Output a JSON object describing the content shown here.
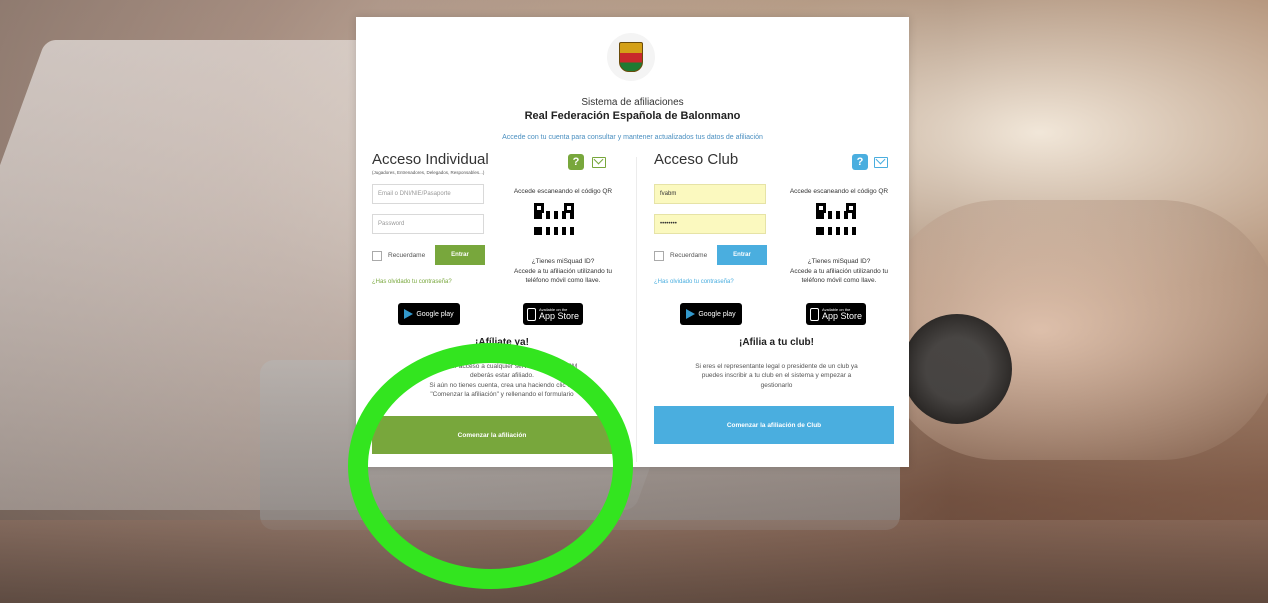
{
  "brand_colors": {
    "green": "#78a73c",
    "blue": "#4aaedf",
    "highlight_ring": "#33e51f"
  },
  "header": {
    "system_name": "Sistema de afiliaciones",
    "federation_name": "Real Federación Española de Balonmano",
    "subtitle": "Accede con tu cuenta para consultar y mantener actualizados tus datos de afiliación",
    "logo_icon": "crest-icon"
  },
  "individual": {
    "title": "Acceso Individual",
    "subtitle": "(Jugadores, Entrenadores, Delegados, Responsables...)",
    "help_icon": "?",
    "email_placeholder": "Email o DNI/NIE/Pasaporte",
    "password_placeholder": "Password",
    "remember_label": "Recuerdame",
    "enter_label": "Entrar",
    "forgot_label": "¿Has olvidado tu contraseña?",
    "qr_title": "Accede escaneando el código QR",
    "qr_question": "¿Tienes miSquad ID?",
    "qr_desc_line1": "Accede a tu afiliación utilizando tu",
    "qr_desc_line2": "teléfono móvil como llave.",
    "google_play_label": "Google play",
    "app_store_small": "Available on the",
    "app_store_big": "App Store",
    "afilia_title": "¡Afíliate ya!",
    "afilia_line1": "Para tener acceso a cualquier servicio de la RFEBM",
    "afilia_line2": "deberás estar afiliado.",
    "afilia_line3": "Si aún no tienes cuenta, crea una haciendo clic en",
    "afilia_line4": "\"Comenzar la afiliación\" y rellenando el formulario",
    "cta_label": "Comenzar la afiliación"
  },
  "club": {
    "title": "Acceso Club",
    "help_icon": "?",
    "username_value": "fvabm",
    "password_value": "••••••••",
    "remember_label": "Recuerdame",
    "enter_label": "Entrar",
    "forgot_label": "¿Has olvidado tu contraseña?",
    "qr_title": "Accede escaneando el código QR",
    "qr_question": "¿Tienes miSquad ID?",
    "qr_desc_line1": "Accede a tu afiliación utilizando tu",
    "qr_desc_line2": "teléfono móvil como llave.",
    "google_play_label": "Google play",
    "app_store_small": "Available on the",
    "app_store_big": "App Store",
    "afilia_title": "¡Afilia a tu club!",
    "afilia_line1": "Si eres el representante legal o presidente de un club ya",
    "afilia_line2": "puedes inscribir a tu club en el sistema y empezar a",
    "afilia_line3": "gestionarlo",
    "cta_label": "Comenzar la afiliación de Club"
  }
}
